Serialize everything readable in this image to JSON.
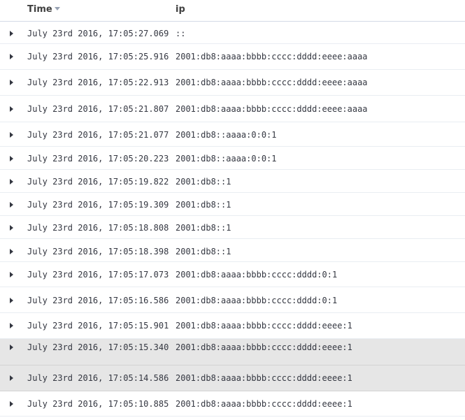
{
  "table": {
    "columns": [
      {
        "label": "Time",
        "sort": "descending"
      },
      {
        "label": "ip"
      }
    ],
    "rows": [
      {
        "time": "July 23rd 2016, 17:05:27.069",
        "ip": "::"
      },
      {
        "time": "July 23rd 2016, 17:05:25.916",
        "ip": "2001:db8:aaaa:bbbb:cccc:dddd:eeee:aaaa"
      },
      {
        "time": "July 23rd 2016, 17:05:22.913",
        "ip": "2001:db8:aaaa:bbbb:cccc:dddd:eeee:aaaa"
      },
      {
        "time": "July 23rd 2016, 17:05:21.807",
        "ip": "2001:db8:aaaa:bbbb:cccc:dddd:eeee:aaaa"
      },
      {
        "time": "July 23rd 2016, 17:05:21.077",
        "ip": "2001:db8::aaaa:0:0:1"
      },
      {
        "time": "July 23rd 2016, 17:05:20.223",
        "ip": "2001:db8::aaaa:0:0:1"
      },
      {
        "time": "July 23rd 2016, 17:05:19.822",
        "ip": "2001:db8::1"
      },
      {
        "time": "July 23rd 2016, 17:05:19.309",
        "ip": "2001:db8::1"
      },
      {
        "time": "July 23rd 2016, 17:05:18.808",
        "ip": "2001:db8::1"
      },
      {
        "time": "July 23rd 2016, 17:05:18.398",
        "ip": "2001:db8::1"
      },
      {
        "time": "July 23rd 2016, 17:05:17.073",
        "ip": "2001:db8:aaaa:bbbb:cccc:dddd:0:1"
      },
      {
        "time": "July 23rd 2016, 17:05:16.586",
        "ip": "2001:db8:aaaa:bbbb:cccc:dddd:0:1"
      },
      {
        "time": "July 23rd 2016, 17:05:15.901",
        "ip": "2001:db8:aaaa:bbbb:cccc:dddd:eeee:1"
      },
      {
        "time": "July 23rd 2016, 17:05:15.340",
        "ip": "2001:db8:aaaa:bbbb:cccc:dddd:eeee:1",
        "highlighted": true
      },
      {
        "time": "July 23rd 2016, 17:05:14.586",
        "ip": "2001:db8:aaaa:bbbb:cccc:dddd:eeee:1",
        "highlighted": true
      },
      {
        "time": "July 23rd 2016, 17:05:10.885",
        "ip": "2001:db8:aaaa:bbbb:cccc:dddd:eeee:1"
      }
    ]
  },
  "icons": {
    "row_toggle": "caret-right-icon",
    "sort": "sort-descending-icon"
  }
}
